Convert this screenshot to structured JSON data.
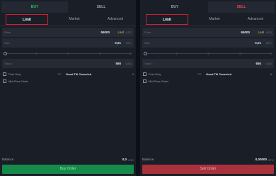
{
  "buy_panel": {
    "tabs": {
      "buy": "BUY",
      "sell": "SELL"
    },
    "order_tabs": {
      "limit": "Limit",
      "market": "Market",
      "advanced": "Advanced"
    },
    "price": {
      "label": "Price",
      "value": "59000",
      "last": "Last",
      "unit": "USD"
    },
    "size": {
      "label": "Size",
      "value": "0,01",
      "unit": "BTC"
    },
    "total": {
      "label": "Total ≈",
      "value": "590",
      "unit": "USD"
    },
    "post_only": "Post Only",
    "tif_label": "TIF",
    "tif_value": "Good Till Canceled",
    "mid_price": "Mid Price Order",
    "balance": {
      "label": "Balance",
      "value": "0,0",
      "unit": "USD"
    },
    "action": "Buy Order"
  },
  "sell_panel": {
    "tabs": {
      "buy": "BUY",
      "sell": "SELL"
    },
    "order_tabs": {
      "limit": "Limit",
      "market": "Market",
      "advanced": "Advanced"
    },
    "price": {
      "label": "Price",
      "value": "65000",
      "last": "Last",
      "unit": "USD"
    },
    "size": {
      "label": "Size",
      "value": "0,01",
      "unit": "BTC"
    },
    "total": {
      "label": "Total ≈",
      "value": "650",
      "unit": "USD"
    },
    "post_only": "Post Only",
    "tif_label": "TIF",
    "tif_value": "Good Till Canceled",
    "mid_price": "Mid Price Order",
    "balance": {
      "label": "Balance",
      "value": "0,00000",
      "unit": "BTC"
    },
    "action": "Sell Order"
  },
  "colors": {
    "buy_accent": "#22c55e",
    "sell_accent": "#ef4444",
    "highlight_border": "#d01f2e",
    "last_price": "#f5b942"
  }
}
